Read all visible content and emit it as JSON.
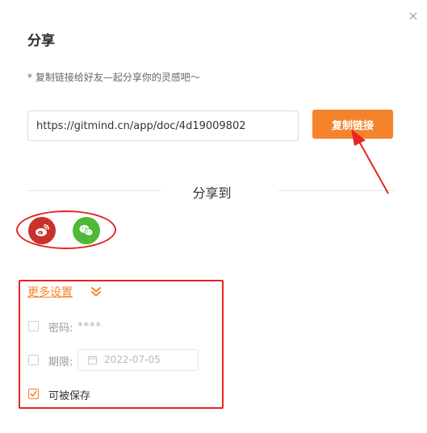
{
  "dialog": {
    "title": "分享",
    "subtitle": "* 复制链接给好友—起分享你的灵感吧～",
    "link_value": "https://gitmind.cn/app/doc/4d19009802",
    "copy_button": "复制链接",
    "share_to": "分享到",
    "social": [
      {
        "name": "weibo",
        "icon": "weibo-icon",
        "color": "#c9312c"
      },
      {
        "name": "wechat",
        "icon": "wechat-icon",
        "color": "#4fb935"
      }
    ],
    "more_settings": "更多设置",
    "options": {
      "password": {
        "label": "密码:",
        "value": "****",
        "checked": false
      },
      "expiry": {
        "label": "期限:",
        "date": "2022-07-05",
        "checked": false
      },
      "savable": {
        "label": "可被保存",
        "checked": true
      }
    }
  },
  "colors": {
    "accent": "#f5832c",
    "annotation_red": "#e52521"
  }
}
